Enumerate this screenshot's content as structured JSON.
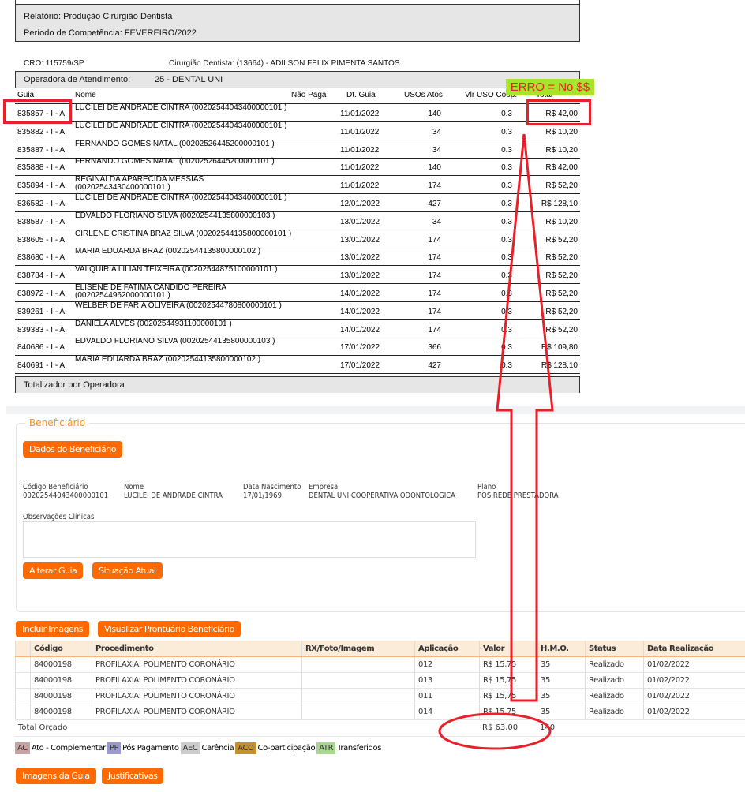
{
  "report": {
    "relatorio": "Relatório:  Produção Cirurgião Dentista",
    "periodo": "Período de Competência:  FEVEREIRO/2022",
    "cro": "CRO:  115759/SP",
    "dentista": "Cirurgião Dentista: (13664) - ADILSON FELIX PIMENTA SANTOS",
    "operadora_label": "Operadora de Atendimento:",
    "operadora": "25 - DENTAL UNI",
    "annotation": "ERRO = No $$",
    "columns": [
      "Guia",
      "Nome",
      "Não Paga",
      "Dt. Guia",
      "USOs Atos",
      "Vlr USO Coop.",
      "Total"
    ],
    "rows": [
      [
        "835857 - I - A",
        "LUCILEI DE ANDRADE CINTRA (00202544043400000101 )",
        "11/01/2022",
        "140",
        "0.3",
        "R$ 42,00"
      ],
      [
        "835882 - I - A",
        "LUCILEI DE ANDRADE CINTRA (00202544043400000101 )",
        "11/01/2022",
        "34",
        "0.3",
        "R$ 10,20"
      ],
      [
        "835887 - I - A",
        "FERNANDO GOMES NATAL (00202526445200000101 )",
        "11/01/2022",
        "34",
        "0.3",
        "R$ 10,20"
      ],
      [
        "835888 - I - A",
        "FERNANDO GOMES NATAL (00202526445200000101 )",
        "11/01/2022",
        "140",
        "0.3",
        "R$ 42,00"
      ],
      [
        "835894 - I - A",
        "REGINALDA APARECIDA MESSIAS (00202543430400000101 )",
        "11/01/2022",
        "174",
        "0.3",
        "R$ 52,20"
      ],
      [
        "836582 - I - A",
        "LUCILEI DE ANDRADE CINTRA (00202544043400000101 )",
        "12/01/2022",
        "427",
        "0.3",
        "R$ 128,10"
      ],
      [
        "838587 - I - A",
        "EDVALDO FLORIANO SILVA (00202544135800000103 )",
        "13/01/2022",
        "34",
        "0.3",
        "R$ 10,20"
      ],
      [
        "838605 - I - A",
        "CIRLENE CRISTINA BRAZ SILVA (00202544135800000101 )",
        "13/01/2022",
        "174",
        "0.3",
        "R$ 52,20"
      ],
      [
        "838680 - I - A",
        "MARIA EDUARDA BRAZ (00202544135800000102 )",
        "13/01/2022",
        "174",
        "0.3",
        "R$ 52,20"
      ],
      [
        "838784 - I - A",
        "VALQUIRIA LILIAN TEIXEIRA (00202544875100000101 )",
        "13/01/2022",
        "174",
        "0.3",
        "R$ 52,20"
      ],
      [
        "838972 - I - A",
        "ELISENE DE FATIMA CANDIDO PEREIRA (00202544962000000101 )",
        "14/01/2022",
        "174",
        "0.3",
        "R$ 52,20"
      ],
      [
        "839261 - I - A",
        "WELBER DE FARIA OLIVEIRA (00202544780800000101 )",
        "14/01/2022",
        "174",
        "0.3",
        "R$ 52,20"
      ],
      [
        "839383 - I - A",
        "DANIELA ALVES (00202544931100000101 )",
        "14/01/2022",
        "174",
        "0.3",
        "R$ 52,20"
      ],
      [
        "840686 - I - A",
        "EDVALDO FLORIANO SILVA (00202544135800000103 )",
        "17/01/2022",
        "366",
        "0.3",
        "R$ 109,80"
      ],
      [
        "840691 - I - A",
        "MARIA EDUARDA BRAZ (00202544135800000102 )",
        "17/01/2022",
        "427",
        "0.3",
        "R$ 128,10"
      ]
    ],
    "totalizador": "Totalizador por Operadora"
  },
  "benef": {
    "legend": "Beneficiário",
    "dados_btn": "Dados do Beneficiário",
    "fields": [
      [
        "Código Beneficiário",
        "00202544043400000101"
      ],
      [
        "Nome",
        "LUCILEI DE ANDRADE CINTRA"
      ],
      [
        "Data Nascimento",
        "17/01/1969"
      ],
      [
        "Empresa",
        "DENTAL UNI COOPERATIVA ODONTOLOGICA"
      ],
      [
        "Plano",
        "POS REDE PRESTADORA"
      ]
    ],
    "obs_label": "Observações Clínicas",
    "alterar": "Alterar Guia",
    "situacao": "Situação Atual"
  },
  "actions": {
    "incluir": "Incluir Imagens",
    "visualizar": "Visualizar Prontuário Beneficiário",
    "imagens_guia": "Imagens da Guia",
    "justificativas": "Justificativas"
  },
  "proc": {
    "columns": [
      "Código",
      "Procedimento",
      "RX/Foto/Imagem",
      "Aplicação",
      "Valor",
      "H.M.O.",
      "Status",
      "Data Realização"
    ],
    "rows": [
      [
        "84000198",
        "PROFILAXIA: POLIMENTO CORONÁRIO",
        "",
        "012",
        "R$ 15,75",
        "35",
        "Realizado",
        "01/02/2022"
      ],
      [
        "84000198",
        "PROFILAXIA: POLIMENTO CORONÁRIO",
        "",
        "013",
        "R$ 15,75",
        "35",
        "Realizado",
        "01/02/2022"
      ],
      [
        "84000198",
        "PROFILAXIA: POLIMENTO CORONÁRIO",
        "",
        "011",
        "R$ 15,75",
        "35",
        "Realizado",
        "01/02/2022"
      ],
      [
        "84000198",
        "PROFILAXIA: POLIMENTO CORONÁRIO",
        "",
        "014",
        "R$ 15,75",
        "35",
        "Realizado",
        "01/02/2022"
      ]
    ],
    "total_label": "Total Orçado",
    "total_valor": "R$ 63,00",
    "total_hmo": "140"
  },
  "legend": [
    {
      "code": "AC",
      "label": "Ato - Complementar",
      "color": "#c9a3a3"
    },
    {
      "code": "PP",
      "label": "Pós Pagamento",
      "color": "#9a9ad0"
    },
    {
      "code": "AEC",
      "label": "Carência",
      "color": "#cccccc"
    },
    {
      "code": "ACO",
      "label": "Co-participação",
      "color": "#c8902a"
    },
    {
      "code": "ATR",
      "label": "Transferidos",
      "color": "#a8d890"
    }
  ],
  "colors": {
    "accent": "#ff6a00",
    "annotation": "#e8202a",
    "annotation_bg": "#a6e62a"
  }
}
